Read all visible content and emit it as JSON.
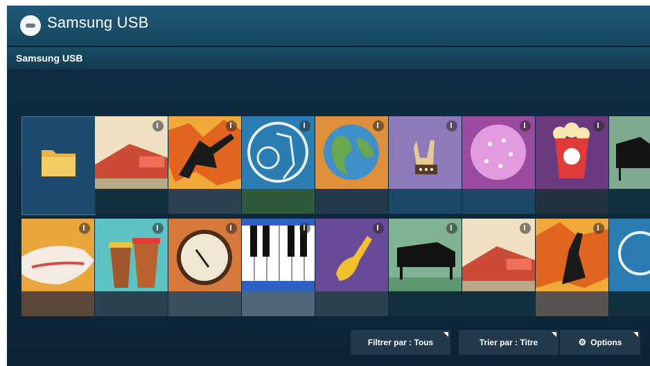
{
  "header": {
    "title": "Samsung USB",
    "logo_icon": "usb-drive-icon"
  },
  "breadcrumb": {
    "text": "Samsung USB"
  },
  "grid": {
    "row1": [
      {
        "icon": "folder-icon",
        "selected": true
      },
      {
        "icon": "barn-icon"
      },
      {
        "icon": "electric-guitar-icon"
      },
      {
        "icon": "guitarist-icon"
      },
      {
        "icon": "globe-icon"
      },
      {
        "icon": "rock-hand-icon"
      },
      {
        "icon": "disco-ball-icon"
      },
      {
        "icon": "popcorn-icon"
      },
      {
        "icon": "piano-icon"
      }
    ],
    "row2": [
      {
        "icon": "cowboy-hat-icon"
      },
      {
        "icon": "bongo-drums-icon"
      },
      {
        "icon": "banjo-icon"
      },
      {
        "icon": "keyboard-icon"
      },
      {
        "icon": "saxophone-icon"
      },
      {
        "icon": "grand-piano-icon"
      },
      {
        "icon": "barn-icon"
      },
      {
        "icon": "electric-guitar-icon"
      },
      {
        "icon": "guitarist-icon"
      }
    ]
  },
  "footer": {
    "filter_label": "Filtrer par : Tous",
    "sort_label": "Trier par : Titre",
    "options_label": "Options",
    "options_icon": "gear-icon"
  },
  "colors": {
    "background": "#0f2a3f",
    "titlebar": "#1f5a78",
    "button": "#22384b"
  }
}
